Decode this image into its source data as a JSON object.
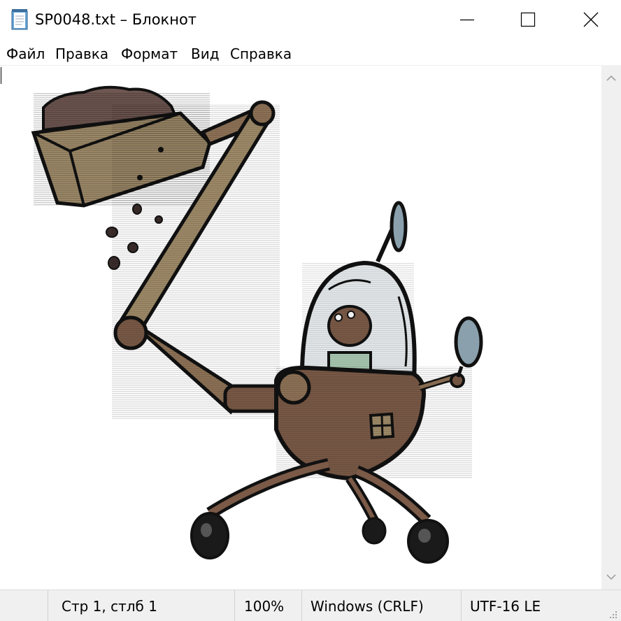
{
  "window": {
    "title": "SP0048.txt – Блокнот",
    "app_icon": "notepad-icon",
    "controls": {
      "minimize": "minimize-icon",
      "maximize": "maximize-icon",
      "close": "close-icon"
    }
  },
  "menu": {
    "items": [
      {
        "label": "Файл"
      },
      {
        "label": "Правка"
      },
      {
        "label": "Формат"
      },
      {
        "label": "Вид"
      },
      {
        "label": "Справка"
      }
    ]
  },
  "editor": {
    "content": "ASCII-art colored drawing: a robot vehicle with glass dome, driver inside, and an extendable arm holding a bucket spilling dirt",
    "colors": {
      "outline": "#111111",
      "brown": "#7b5a47",
      "tan": "#a08c6a",
      "dome": "#e6ebee",
      "dirt": "#6e5651",
      "rod": "#8f7357",
      "antenna": "#8aa0ad",
      "wheel": "#1a1a1a"
    }
  },
  "scrollbar": {
    "up_icon": "scroll-up-arrow-icon",
    "down_icon": "scroll-down-arrow-icon"
  },
  "status": {
    "position": "Стр 1, стлб 1",
    "zoom": "100%",
    "line_ending": "Windows (CRLF)",
    "encoding": "UTF-16 LE"
  }
}
